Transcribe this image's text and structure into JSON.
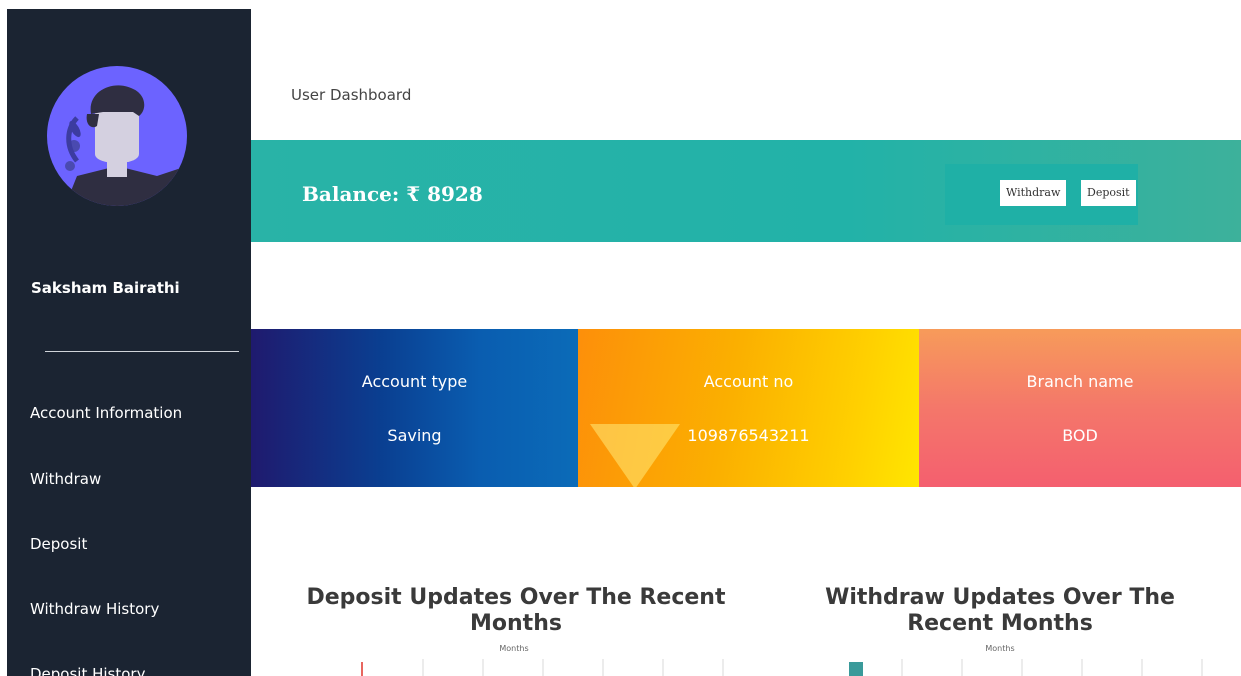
{
  "sidebar": {
    "user_name": "Saksham Bairathi",
    "avatar_icon": "user-avatar-icon",
    "items": [
      {
        "label": "Account Information"
      },
      {
        "label": "Withdraw"
      },
      {
        "label": "Deposit"
      },
      {
        "label": "Withdraw History"
      },
      {
        "label": "Deposit History"
      }
    ]
  },
  "header": {
    "title": "User Dashboard"
  },
  "balance": {
    "label": "Balance: ₹ 8928",
    "withdraw_button": "Withdraw",
    "deposit_button": "Deposit"
  },
  "cards": {
    "account_type": {
      "label": "Account type",
      "value": "Saving"
    },
    "account_no": {
      "label": "Account no",
      "value": "109876543211"
    },
    "branch": {
      "label": "Branch name",
      "value": "BOD"
    }
  },
  "colors": {
    "sidebar_bg": "#1b2432",
    "teal": "#22b2a8",
    "deposit_bar": "#e8665f",
    "withdraw_bar": "#3a9a9a"
  },
  "chart_data": [
    {
      "type": "bar",
      "title": "Deposit Updates Over The Recent Months",
      "xlabel": "Months",
      "grid": true,
      "bar_color": "#e8665f"
    },
    {
      "type": "bar",
      "title": "Withdraw Updates Over The Recent Months",
      "xlabel": "Months",
      "grid": true,
      "bar_color": "#3a9a9a"
    }
  ]
}
